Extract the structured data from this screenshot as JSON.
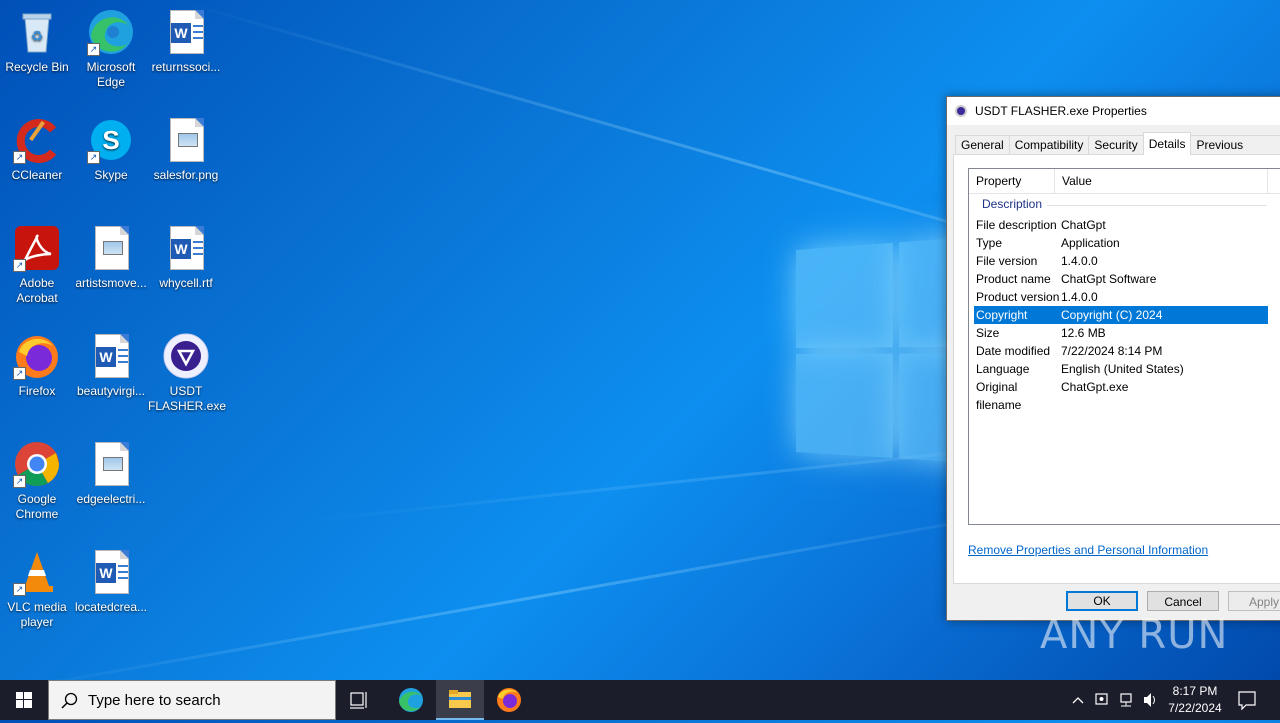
{
  "desktop": {
    "icons": [
      {
        "label": "Recycle Bin"
      },
      {
        "label": "Microsoft Edge"
      },
      {
        "label": "returnssoci..."
      },
      {
        "label": "CCleaner"
      },
      {
        "label": "Skype"
      },
      {
        "label": "salesfor.png"
      },
      {
        "label": "Adobe Acrobat"
      },
      {
        "label": "artistsmove..."
      },
      {
        "label": "whycell.rtf"
      },
      {
        "label": "Firefox"
      },
      {
        "label": "beautyvirgi..."
      },
      {
        "label": "USDT FLASHER.exe"
      },
      {
        "label": "Google Chrome"
      },
      {
        "label": "edgeelectri..."
      },
      {
        "label": "VLC media player"
      },
      {
        "label": "locatedcrea..."
      }
    ]
  },
  "dialog": {
    "title": "USDT FLASHER.exe Properties",
    "tabs": [
      {
        "label": "General"
      },
      {
        "label": "Compatibility"
      },
      {
        "label": "Security"
      },
      {
        "label": "Details"
      },
      {
        "label": "Previous Versions"
      }
    ],
    "active_tab": "Details",
    "columns": {
      "property": "Property",
      "value": "Value"
    },
    "group": "Description",
    "rows": [
      {
        "property": "File description",
        "value": "ChatGpt"
      },
      {
        "property": "Type",
        "value": "Application"
      },
      {
        "property": "File version",
        "value": "1.4.0.0"
      },
      {
        "property": "Product name",
        "value": "ChatGpt Software"
      },
      {
        "property": "Product version",
        "value": "1.4.0.0"
      },
      {
        "property": "Copyright",
        "value": "Copyright (C) 2024"
      },
      {
        "property": "Size",
        "value": "12.6 MB"
      },
      {
        "property": "Date modified",
        "value": "7/22/2024 8:14 PM"
      },
      {
        "property": "Language",
        "value": "English (United States)"
      },
      {
        "property": "Original filename",
        "value": "ChatGpt.exe"
      }
    ],
    "selected_row": "Copyright",
    "remove_link": "Remove Properties and Personal Information",
    "buttons": {
      "ok": "OK",
      "cancel": "Cancel",
      "apply": "Apply"
    }
  },
  "taskbar": {
    "search_placeholder": "Type here to search",
    "time": "8:17 PM",
    "date": "7/22/2024"
  },
  "watermark": "ANY RUN",
  "colors": {
    "accent": "#0078d7",
    "taskbar": "#1b1d2a",
    "link": "#0066cc"
  }
}
